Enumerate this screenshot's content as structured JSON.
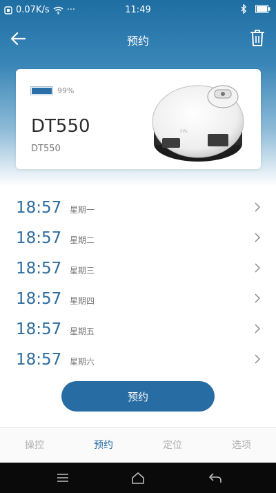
{
  "status_bar": {
    "speed": "0.07K/s",
    "dots": "···",
    "time": "11:49"
  },
  "header": {
    "title": "预约"
  },
  "device": {
    "battery_percent": "99%",
    "battery_level": 0.99,
    "name": "DT550",
    "model": "DT550"
  },
  "schedules": [
    {
      "time": "18:57",
      "day": "星期一"
    },
    {
      "time": "18:57",
      "day": "星期二"
    },
    {
      "time": "18:57",
      "day": "星期三"
    },
    {
      "time": "18:57",
      "day": "星期四"
    },
    {
      "time": "18:57",
      "day": "星期五"
    },
    {
      "time": "18:57",
      "day": "星期六"
    }
  ],
  "book_button": "预约",
  "tabs": [
    "操控",
    "预约",
    "定位",
    "选项"
  ],
  "active_tab": 1,
  "colors": {
    "accent": "#276ca3",
    "tab_inactive": "#b0b0b0"
  }
}
